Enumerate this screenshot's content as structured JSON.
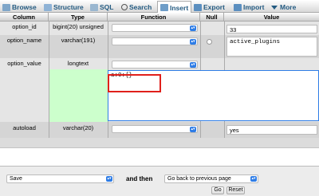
{
  "tabs": [
    {
      "label": "Browse",
      "icon": "browse-icon"
    },
    {
      "label": "Structure",
      "icon": "structure-icon"
    },
    {
      "label": "SQL",
      "icon": "sql-icon"
    },
    {
      "label": "Search",
      "icon": "search-icon"
    },
    {
      "label": "Insert",
      "icon": "insert-icon",
      "active": true
    },
    {
      "label": "Export",
      "icon": "export-icon"
    },
    {
      "label": "Import",
      "icon": "import-icon"
    },
    {
      "label": "More",
      "icon": "chevron-down-icon"
    }
  ],
  "headers": {
    "column": "Column",
    "type": "Type",
    "function": "Function",
    "null": "Null",
    "value": "Value"
  },
  "rows": [
    {
      "column": "option_id",
      "type": "bigint(20) unsigned",
      "value": "33"
    },
    {
      "column": "option_name",
      "type": "varchar(191)",
      "value": "active_plugins"
    },
    {
      "column": "option_value",
      "type": "longtext",
      "value": "a:0:{}"
    },
    {
      "column": "autoload",
      "type": "varchar(20)",
      "value": "yes"
    }
  ],
  "bottom": {
    "save_option": "Save",
    "and_then": "and then",
    "after_option": "Go back to previous page",
    "go": "Go",
    "reset": "Reset"
  },
  "colors": {
    "accent": "#235a81",
    "highlight": "#ccffcc",
    "focus_border": "#2f7de6",
    "annotation_box": "#e0201b"
  }
}
